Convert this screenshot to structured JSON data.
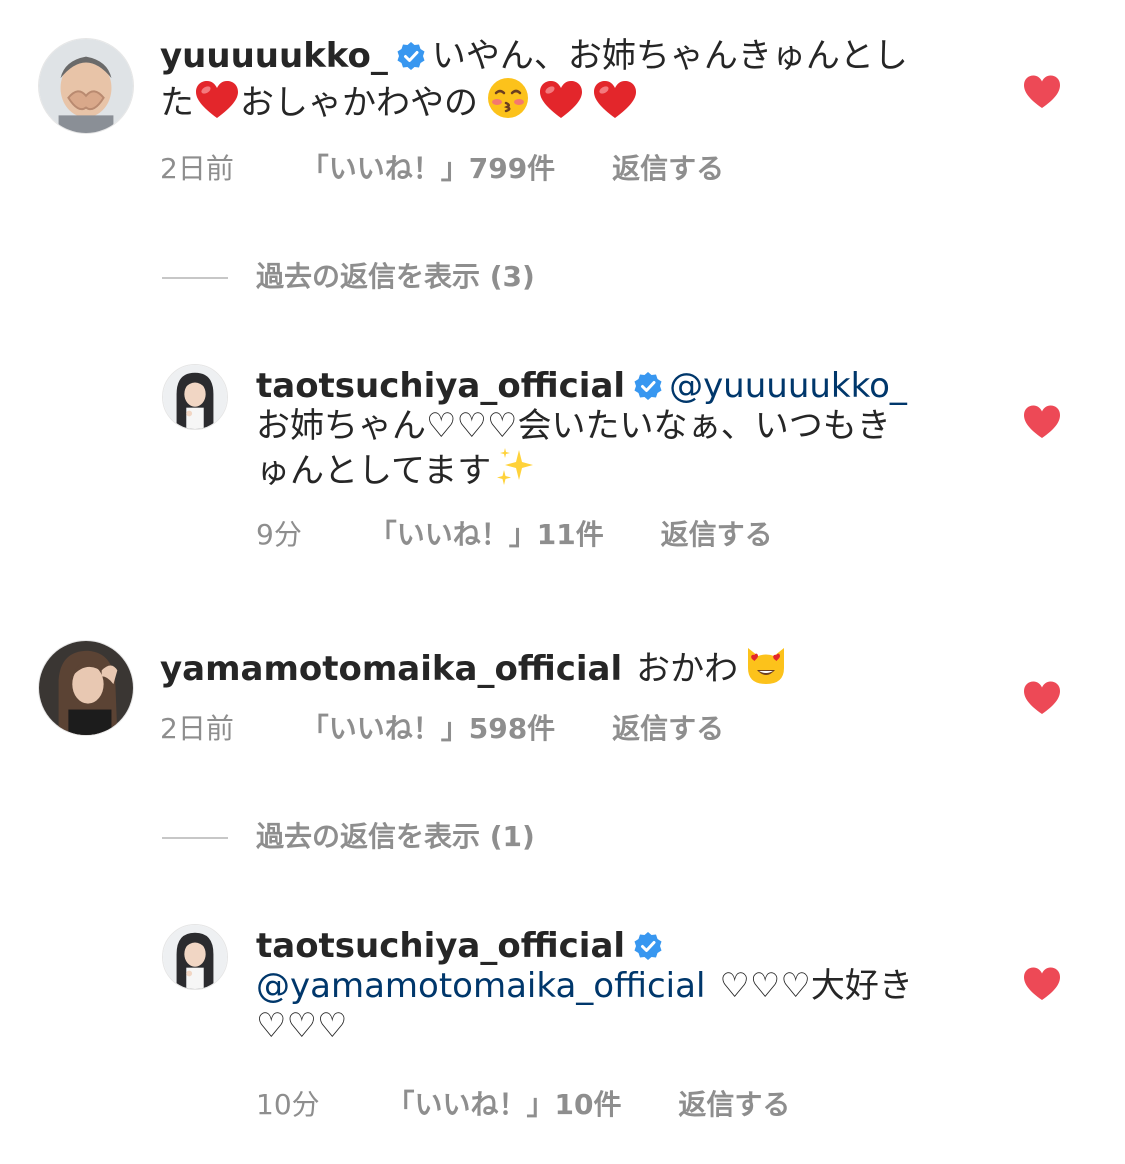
{
  "colors": {
    "heart": "#ed4956",
    "verified": "#3897f0",
    "mention": "#00376b",
    "meta": "#8e8e8e"
  },
  "comments": [
    {
      "username": "yuuuuukko_",
      "verified": true,
      "text_line1": "いやん、お姉ちゃんきゅんとし",
      "text_line2a": "た",
      "text_line2b": "おしゃかわやの",
      "time": "2日前",
      "likes": "「いいね！」799件",
      "reply": "返信する",
      "liked": true
    },
    {
      "view_replies": "過去の返信を表示 (3)"
    },
    {
      "username": "taotsuchiya_official",
      "verified": true,
      "mention": "@yuuuuukko_",
      "text_line1": "お姉ちゃん♡♡♡会いたいなぁ、いつもき",
      "text_line2": "ゅんとしてます",
      "time": "9分",
      "likes": "「いいね！」11件",
      "reply": "返信する",
      "liked": true
    },
    {
      "username": "yamamotomaika_official",
      "verified": false,
      "text": "おかわ",
      "time": "2日前",
      "likes": "「いいね！」598件",
      "reply": "返信する",
      "liked": true
    },
    {
      "view_replies": "過去の返信を表示 (1)"
    },
    {
      "username": "taotsuchiya_official",
      "verified": true,
      "mention": "@yamamotomaika_official",
      "text_line1_tail": "♡♡♡大好き",
      "text_line2": "♡♡♡",
      "time": "10分",
      "likes": "「いいね！」10件",
      "reply": "返信する",
      "liked": true
    }
  ],
  "icons": {
    "verified": "verified-badge-icon",
    "like": "heart-icon",
    "emoji_heart": "red-heart-emoji",
    "emoji_kiss": "kissing-face-emoji",
    "emoji_sparkles": "sparkles-emoji",
    "emoji_cat": "heart-eyes-cat-emoji"
  }
}
